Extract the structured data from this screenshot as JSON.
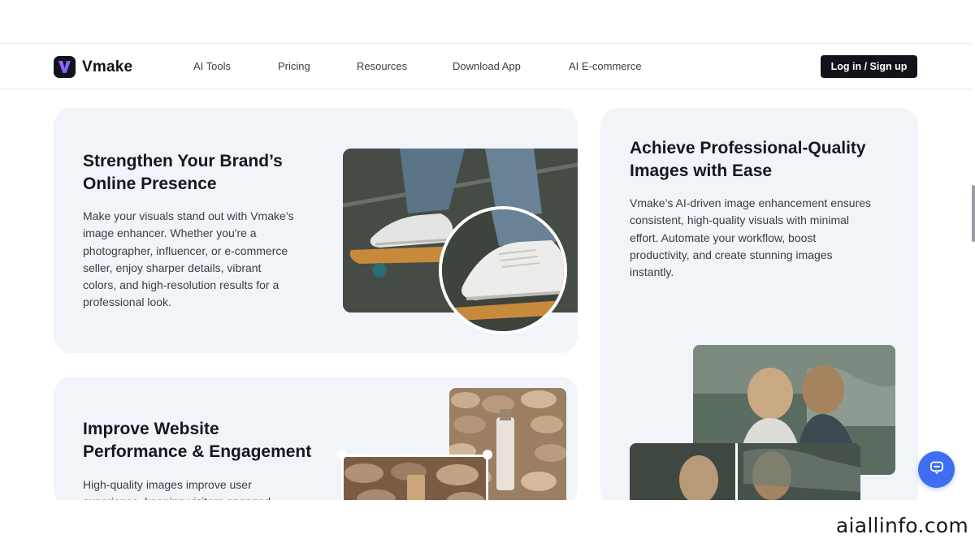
{
  "brand": {
    "name": "Vmake",
    "logo_letter": "V"
  },
  "nav": {
    "items": [
      {
        "label": "AI Tools"
      },
      {
        "label": "Pricing"
      },
      {
        "label": "Resources"
      },
      {
        "label": "Download App"
      },
      {
        "label": "AI E-commerce"
      }
    ],
    "login_label": "Log in / Sign up"
  },
  "cards": [
    {
      "title_line1": "Strengthen Your Brand’s",
      "title_line2": "Online Presence",
      "body": [
        "Make your visuals stand out with Vmake’s",
        "image enhancer. Whether you're a",
        "photographer, influencer, or e-commerce",
        "seller, enjoy sharper details, vibrant",
        "colors, and high-resolution results for a",
        "professional look."
      ]
    },
    {
      "title_line1": "Improve Website",
      "title_line2": "Performance & Engagement",
      "body": [
        "High-quality images improve user",
        "experience, keeping visitors engaged"
      ]
    },
    {
      "title_line1": "Achieve Professional-Quality",
      "title_line2": "Images with Ease",
      "body": [
        "Vmake’s AI-driven image enhancement ensures",
        "consistent, high-quality visuals with minimal",
        "effort. Automate your workflow, boost",
        "productivity, and create stunning images",
        "instantly."
      ]
    }
  ],
  "watermark": "aiallinfo.com",
  "colors": {
    "card_bg": "#f1f4f9",
    "dark": "#12131a",
    "accent": "#3f6ef0"
  },
  "icons": {
    "logo": "vmake-logo-icon",
    "chat": "chat-icon"
  }
}
